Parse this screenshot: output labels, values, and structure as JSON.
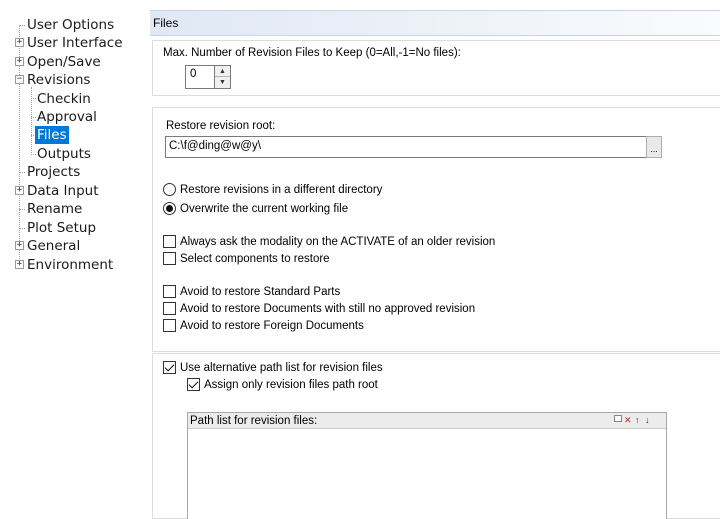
{
  "tree": {
    "items": [
      {
        "label": "User Options",
        "expander": ""
      },
      {
        "label": "User Interface",
        "expander": "+"
      },
      {
        "label": "Open/Save",
        "expander": "+"
      },
      {
        "label": "Revisions",
        "expander": "−"
      },
      {
        "label": "Checkin",
        "expander": ""
      },
      {
        "label": "Approval",
        "expander": ""
      },
      {
        "label": "Files",
        "expander": "",
        "selected": true
      },
      {
        "label": "Outputs",
        "expander": ""
      },
      {
        "label": "Projects",
        "expander": ""
      },
      {
        "label": "Data Input",
        "expander": "+"
      },
      {
        "label": "Rename",
        "expander": ""
      },
      {
        "label": "Plot Setup",
        "expander": ""
      },
      {
        "label": "General",
        "expander": "+"
      },
      {
        "label": "Environment",
        "expander": "+"
      }
    ]
  },
  "panel": {
    "title": "Files",
    "max_revisions_label": "Max. Number of Revision Files to Keep (0=All,-1=No files):",
    "max_revisions_value": "0",
    "restore_root_label": "Restore revision root:",
    "restore_root_value": "C:\\f@ding@w@y\\",
    "browse_label": "...",
    "radio_different_dir": "Restore revisions in a different directory",
    "radio_overwrite": "Overwrite the current working file",
    "check_always_ask": "Always ask the modality on the ACTIVATE of an older revision",
    "check_select_components": "Select components to restore",
    "check_avoid_standard": "Avoid to restore Standard Parts",
    "check_avoid_not_approved": "Avoid to restore Documents with still no approved revision",
    "check_avoid_foreign": "Avoid to restore Foreign Documents",
    "check_use_alt_path": "Use alternative path list for revision files",
    "check_assign_root": "Assign only revision files path root",
    "path_list_label": "Path list for revision files:"
  },
  "state": {
    "radio_selected": "overwrite",
    "always_ask": false,
    "select_components": false,
    "avoid_standard": false,
    "avoid_not_approved": false,
    "avoid_foreign": false,
    "use_alt_path": true,
    "assign_root": true
  },
  "icons": {
    "spin_up": "up-arrow-icon",
    "spin_down": "down-arrow-icon",
    "path_toolbar": [
      "new-icon",
      "delete-icon",
      "move-up-icon",
      "move-down-icon"
    ]
  },
  "colors": {
    "selection": "#0078d7",
    "header_gradient_start": "#dfe8f4",
    "delete_red": "#d02020"
  }
}
